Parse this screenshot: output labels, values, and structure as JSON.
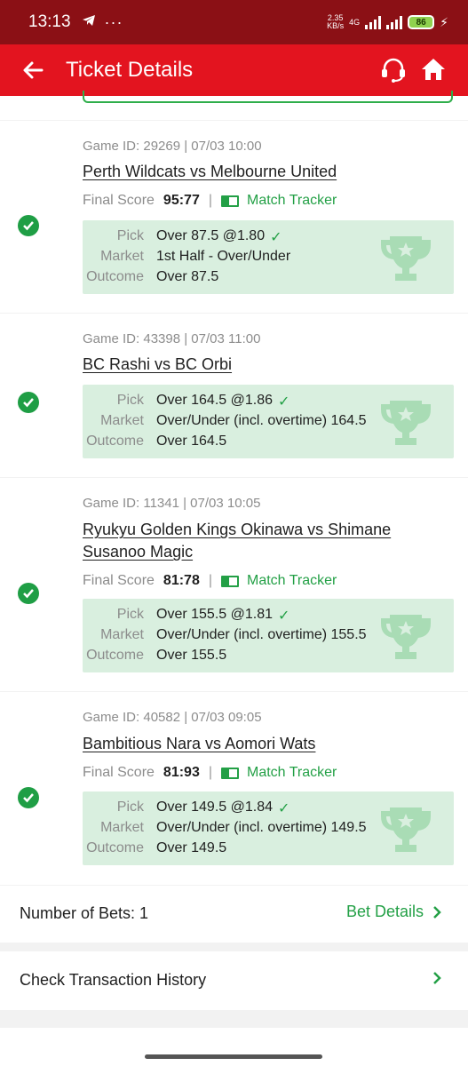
{
  "status_bar": {
    "time": "13:13",
    "net_speed_top": "2.35",
    "net_speed_bottom": "KB/s",
    "network": "4G",
    "battery": "86"
  },
  "header": {
    "title": "Ticket Details"
  },
  "labels": {
    "final_score": "Final Score",
    "match_tracker": "Match Tracker",
    "pick": "Pick",
    "market": "Market",
    "outcome": "Outcome"
  },
  "games": [
    {
      "game_id": "Game ID: 29269 | 07/03 10:00",
      "match": "Perth Wildcats vs Melbourne United",
      "final_score": "95:77",
      "pick": "Over 87.5 @1.80",
      "market": "1st Half - Over/Under",
      "outcome": "Over 87.5"
    },
    {
      "game_id": "Game ID: 43398 | 07/03 11:00",
      "match": "BC Rashi vs BC Orbi",
      "pick": "Over 164.5 @1.86",
      "market": "Over/Under (incl. overtime)  164.5",
      "outcome": "Over 164.5"
    },
    {
      "game_id": "Game ID: 11341 | 07/03 10:05",
      "match": "Ryukyu Golden Kings Okinawa vs Shimane Susanoo Magic",
      "final_score": "81:78",
      "pick": "Over 155.5 @1.81",
      "market": "Over/Under (incl. overtime) 155.5",
      "outcome": "Over 155.5"
    },
    {
      "game_id": "Game ID: 40582 | 07/03 09:05",
      "match": "Bambitious Nara vs Aomori Wats",
      "final_score": "81:93",
      "pick": "Over 149.5 @1.84",
      "market": "Over/Under (incl. overtime) 149.5",
      "outcome": "Over 149.5"
    }
  ],
  "footer": {
    "number_of_bets": "Number of Bets: 1",
    "bet_details": "Bet Details",
    "check_history": "Check Transaction History"
  }
}
